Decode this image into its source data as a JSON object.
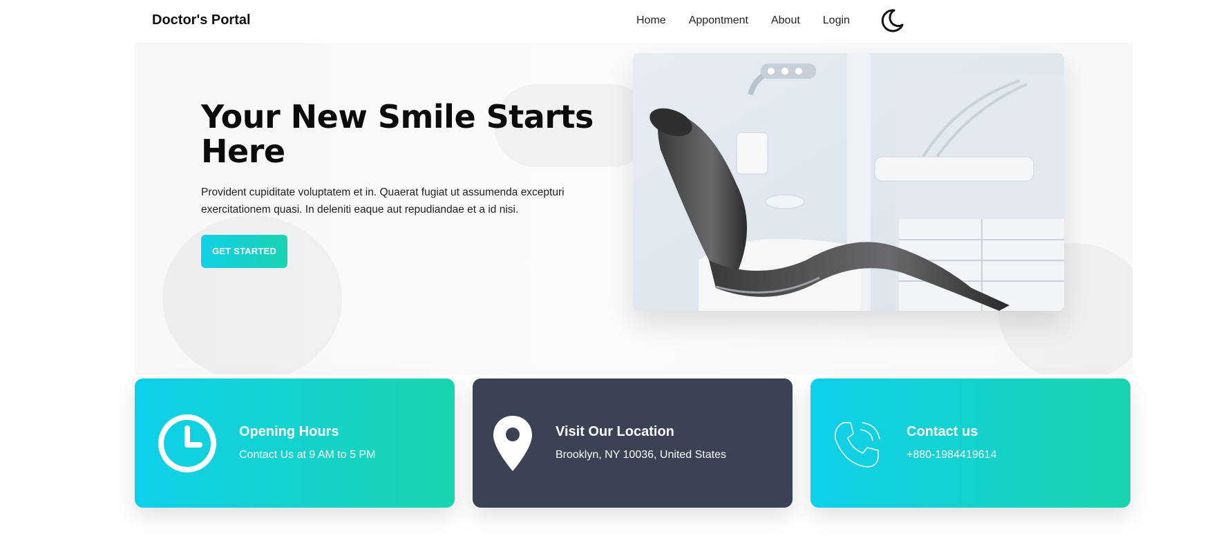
{
  "navbar": {
    "brand": "Doctor's Portal",
    "links": [
      "Home",
      "Appontment",
      "About",
      "Login"
    ],
    "theme_icon": "moon-icon"
  },
  "hero": {
    "title": "Your New Smile Starts Here",
    "description": "Provident cupiditate voluptatem et in. Quaerat fugiat ut assumenda excepturi exercitationem quasi. In deleniti eaque aut repudiandae et a id nisi.",
    "cta_label": "GET STARTED",
    "image_icon": "dental-chair-image"
  },
  "cards": [
    {
      "title": "Opening Hours",
      "subtitle": "Contact Us at 9 AM to 5 PM",
      "icon": "clock-icon",
      "style": "teal"
    },
    {
      "title": "Visit Our Location",
      "subtitle": "Brooklyn, NY 10036, United States",
      "icon": "map-pin-icon",
      "style": "dark"
    },
    {
      "title": "Contact us",
      "subtitle": "+880-1984419614",
      "icon": "phone-icon",
      "style": "teal"
    }
  ],
  "colors": {
    "accent_start": "#12cfe6",
    "accent_end": "#18d2b0",
    "dark_card": "#3a4254"
  }
}
